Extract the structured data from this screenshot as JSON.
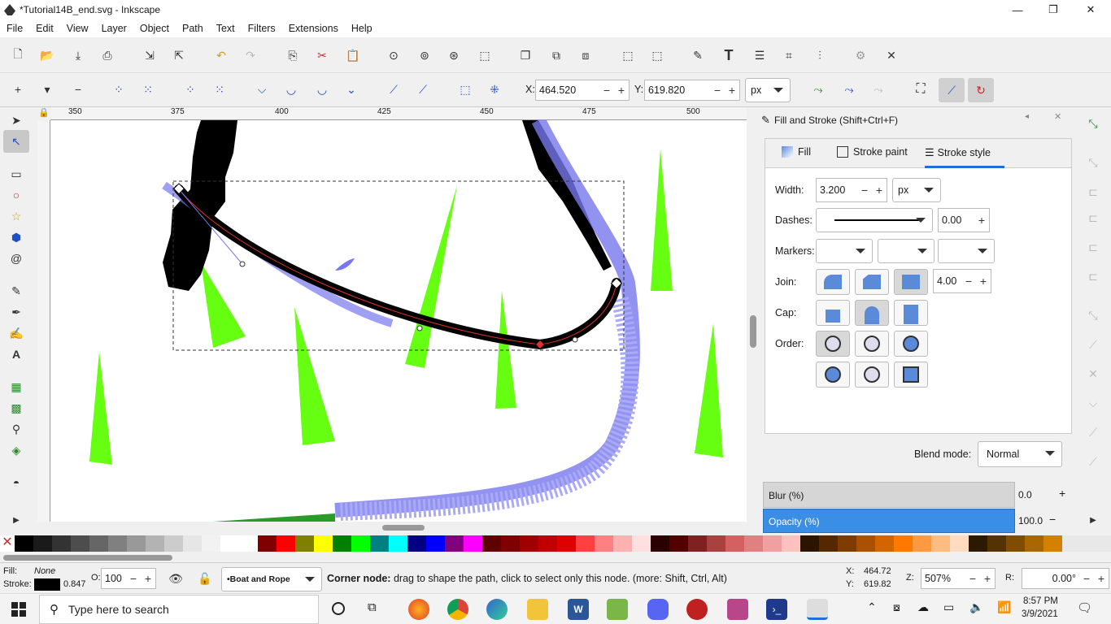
{
  "window": {
    "title": "*Tutorial14B_end.svg - Inkscape",
    "minimize": "—",
    "maximize": "❐",
    "close": "✕"
  },
  "menu": [
    "File",
    "Edit",
    "View",
    "Layer",
    "Object",
    "Path",
    "Text",
    "Filters",
    "Extensions",
    "Help"
  ],
  "controls": {
    "x_label": "X:",
    "x_value": "464.520",
    "y_label": "Y:",
    "y_value": "619.820",
    "unit": "px"
  },
  "rulers": {
    "top": [
      "350",
      "375",
      "400",
      "425",
      "450",
      "475",
      "500"
    ]
  },
  "dialog": {
    "title": "Fill and Stroke (Shift+Ctrl+F)",
    "tabs": [
      "Fill",
      "Stroke paint",
      "Stroke style"
    ],
    "width_label": "Width:",
    "width_value": "3.200",
    "width_unit": "px",
    "dashes_label": "Dashes:",
    "dashes_offset": "0.00",
    "markers_label": "Markers:",
    "join_label": "Join:",
    "miter_value": "4.00",
    "cap_label": "Cap:",
    "order_label": "Order:",
    "blend_label": "Blend mode:",
    "blend_value": "Normal",
    "blur_label": "Blur (%)",
    "blur_value": "0.0",
    "opacity_label": "Opacity (%)",
    "opacity_value": "100.0"
  },
  "palette": [
    "#000000",
    "#1a1a1a",
    "#333333",
    "#4d4d4d",
    "#666666",
    "#808080",
    "#999999",
    "#b3b3b3",
    "#cccccc",
    "#e6e6e6",
    "#f2f2f2",
    "#ffffff",
    "#ffffff",
    "#800000",
    "#ff0000",
    "#808000",
    "#ffff00",
    "#008000",
    "#00ff00",
    "#008080",
    "#00ffff",
    "#000080",
    "#0000ff",
    "#800080",
    "#ff00ff",
    "#5e0000",
    "#800000",
    "#a00000",
    "#c00000",
    "#e00000",
    "#ff4040",
    "#ff8080",
    "#ffb0b0",
    "#ffe0e0",
    "#2b0000",
    "#550000",
    "#802020",
    "#aa4040",
    "#d46060",
    "#e08080",
    "#f0a0a0",
    "#ffc0c0",
    "#2b1400",
    "#552800",
    "#803c00",
    "#aa5000",
    "#d46400",
    "#ff7800",
    "#ff9a40",
    "#ffbb80",
    "#ffdcc0",
    "#2b1a00",
    "#553300",
    "#804d00",
    "#aa6600",
    "#d48000"
  ],
  "status": {
    "fill_label": "Fill:",
    "fill_value": "None",
    "stroke_label": "Stroke:",
    "stroke_width": "0.847",
    "opacity_label": "O:",
    "opacity_value": "100",
    "layer": "•Boat and Rope",
    "message_bold": "Corner node:",
    "message": " drag to shape the path, click to select only this node. (more: Shift, Ctrl, Alt)",
    "x_label": "X:",
    "x_value": "464.72",
    "y_label": "Y:",
    "y_value": "619.82",
    "z_label": "Z:",
    "zoom": "507%",
    "r_label": "R:",
    "rotation": "0.00°"
  },
  "taskbar": {
    "search": "Type here to search",
    "time": "8:57 PM",
    "date": "3/9/2021"
  }
}
